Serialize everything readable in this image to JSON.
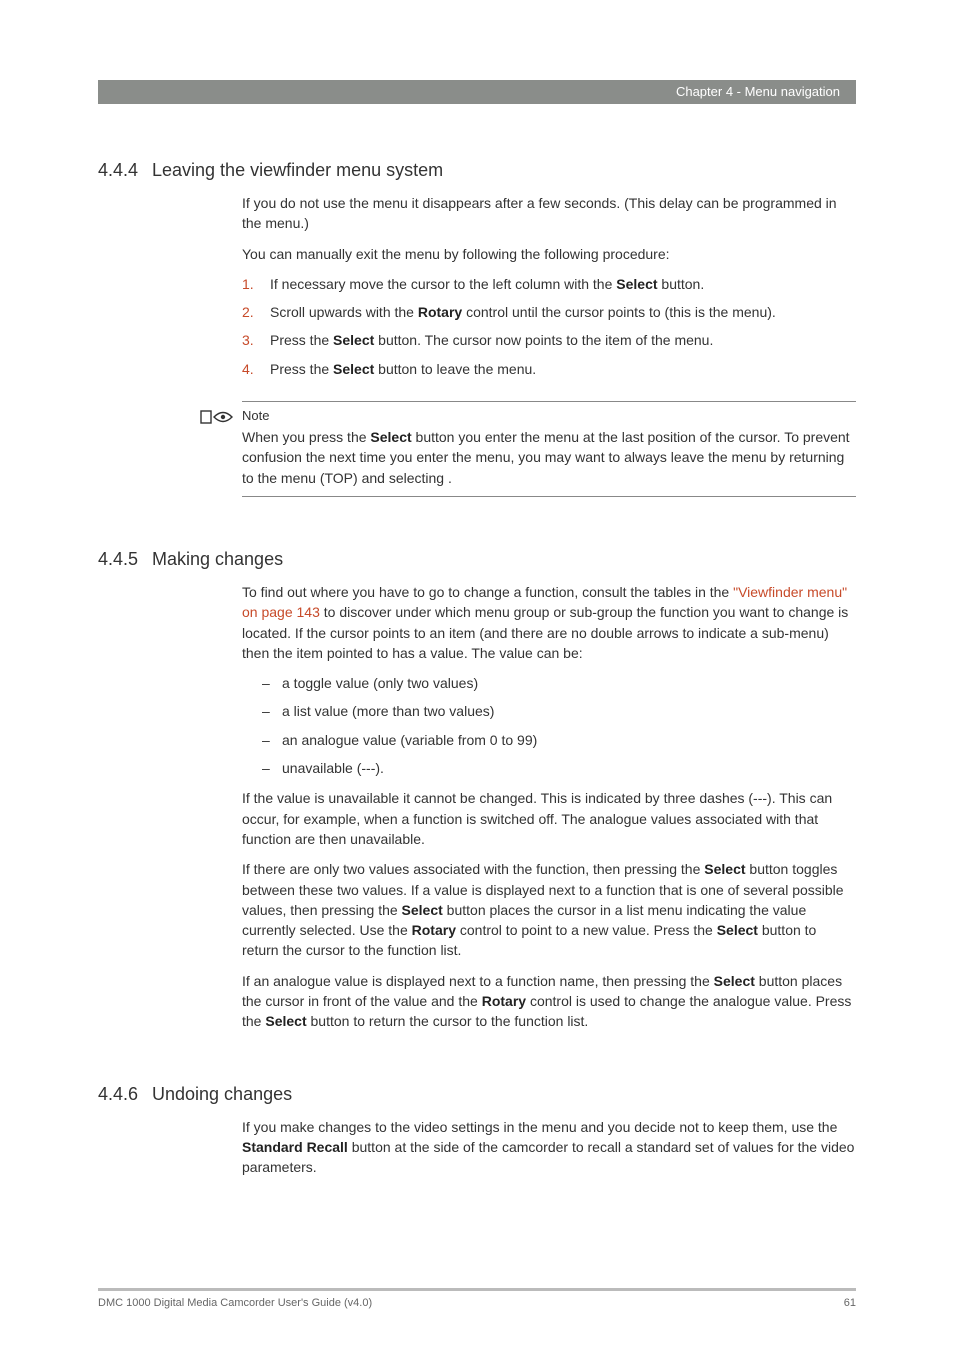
{
  "header": {
    "chapter": "Chapter 4 - Menu navigation"
  },
  "sections": {
    "s1": {
      "num": "4.4.4",
      "title": "Leaving the viewfinder menu system",
      "p1a": "If you do not use the menu it disappears after a few seconds. (This delay can be programmed in the ",
      "p1b": " menu.)",
      "p2": "You can manually exit the menu by following the following procedure:",
      "steps": {
        "n1": "1.",
        "t1a": "If necessary move the cursor to the left column with the ",
        "t1b": " button.",
        "n2": "2.",
        "t2a": "Scroll upwards with the ",
        "t2b": " control until the cursor points to ",
        "t2c": " (this is the ",
        "t2d": " menu).",
        "n3": "3.",
        "t3a": "Press the ",
        "t3b": " button. The cursor now points to the ",
        "t3c": " item of the ",
        "t3d": " menu.",
        "n4": "4.",
        "t4a": "Press the ",
        "t4b": " button to leave the ",
        "t4c": " menu."
      },
      "bold": {
        "select": "Select",
        "rotary": "Rotary"
      }
    },
    "note": {
      "title": "Note",
      "la": "When you press the ",
      "lb": " button you enter the ",
      "lc": " menu at the last position of the cursor. To prevent confusion the next time you enter the ",
      "ld": " menu, you may want to always leave the menu by returning to the ",
      "le": " menu (TOP) and selecting ",
      "lf": "."
    },
    "s2": {
      "num": "4.4.5",
      "title": "Making changes",
      "p1a": "To find out where you have to go to change a function, consult the tables in the ",
      "xref": "\"Viewfinder menu\" on page 143",
      "p1b": " to discover under which menu group or sub-group the function you want to change is located. If the cursor points to an item (and there are no double arrows to indicate a sub-menu) then the item pointed to has a value. The value can be:",
      "bullets": {
        "b1": "a toggle value (only two values)",
        "b2": "a list value (more than two values)",
        "b3": "an analogue value (variable from 0 to 99)",
        "b4": "unavailable (---)."
      },
      "p2": "If the value is unavailable it cannot be changed. This is indicated by three dashes (---). This can occur, for example, when a function is switched off. The analogue values associated with that function are then unavailable.",
      "p3a": "If there are only two values associated with the function, then pressing the ",
      "p3b": " button toggles between these two values. If a value is displayed next to a function that is one of several possible values, then pressing the ",
      "p3c": " button places the cursor in a list menu indicating the value currently selected. Use the ",
      "p3d": " control to point to a new value. Press the ",
      "p3e": " button to return the cursor to the function list.",
      "p4a": "If an analogue value is displayed next to a function name, then pressing the ",
      "p4b": " button places the cursor in front of the value and the ",
      "p4c": " control is used to change the analogue value. Press the ",
      "p4d": " button to return the cursor to the function list."
    },
    "s3": {
      "num": "4.4.6",
      "title": "Undoing changes",
      "p1a": "If you make changes to the video settings in the menu and you decide not to keep them, use the ",
      "p1bold": "Standard Recall",
      "p1b": " button at the side of the camcorder to recall a standard set of values for the video parameters."
    }
  },
  "footer": {
    "left": "DMC 1000 Digital Media Camcorder User's Guide (v4.0)",
    "right": "61"
  }
}
